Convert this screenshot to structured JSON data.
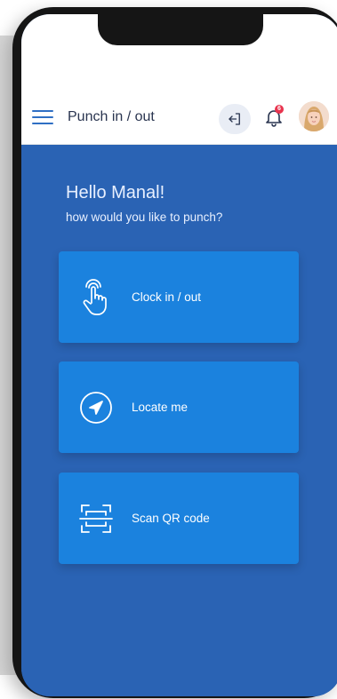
{
  "appbar": {
    "title": "Punch in / out",
    "notification_count": "6"
  },
  "greeting": {
    "hello": "Hello Manal!",
    "subtitle": "how would you like to punch?"
  },
  "options": [
    {
      "label": "Clock in / out",
      "icon": "touch-hand-icon"
    },
    {
      "label": "Locate me",
      "icon": "navigation-arrow-icon"
    },
    {
      "label": "Scan QR code",
      "icon": "qr-scan-icon"
    }
  ],
  "colors": {
    "background": "#2a63b4",
    "card": "#1b82de",
    "accent": "#2f6fc4",
    "badge": "#e8344e"
  }
}
